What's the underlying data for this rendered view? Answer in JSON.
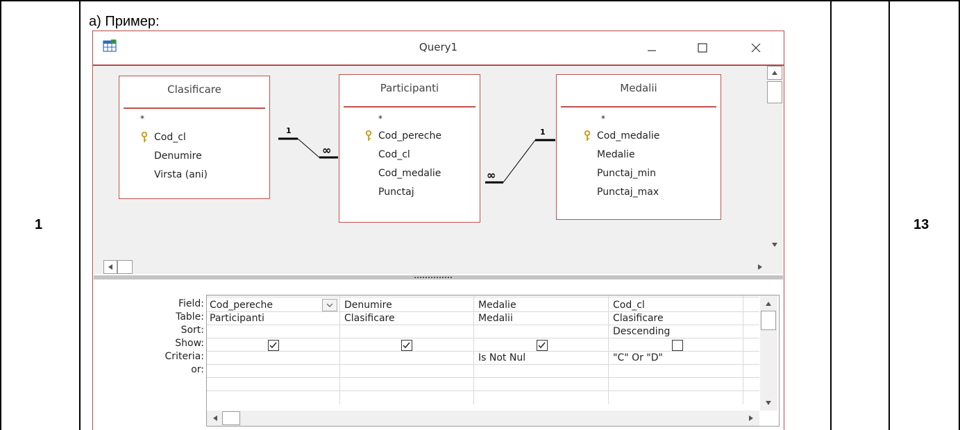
{
  "row": {
    "number": "1",
    "score": "13"
  },
  "example_label": "а) Пример:",
  "window": {
    "title": "Query1"
  },
  "tables": [
    {
      "name": "Clasificare",
      "star": "*",
      "fields": [
        "Cod_cl",
        "Denumire",
        "Virsta (ani)"
      ],
      "key_field": "Cod_cl"
    },
    {
      "name": "Participanti",
      "star": "*",
      "fields": [
        "Cod_pereche",
        "Cod_cl",
        "Cod_medalie",
        "Punctaj"
      ],
      "key_field": "Cod_pereche"
    },
    {
      "name": "Medalii",
      "star": "*",
      "fields": [
        "Cod_medalie",
        "Medalie",
        "Punctaj_min",
        "Punctaj_max"
      ],
      "key_field": "Cod_medalie"
    }
  ],
  "relations": [
    {
      "from": "Clasificare",
      "to": "Participanti",
      "one_label": "1",
      "many_label": "∞"
    },
    {
      "from": "Medalii",
      "to": "Participanti",
      "one_label": "1",
      "many_label": "∞"
    }
  ],
  "grid": {
    "row_labels": [
      "Field:",
      "Table:",
      "Sort:",
      "Show:",
      "Criteria:",
      "or:"
    ],
    "columns": [
      {
        "field": "Cod_pereche",
        "table": "Participanti",
        "sort": "",
        "show": true,
        "criteria": "",
        "or": ""
      },
      {
        "field": "Denumire",
        "table": "Clasificare",
        "sort": "",
        "show": true,
        "criteria": "",
        "or": ""
      },
      {
        "field": "Medalie",
        "table": "Medalii",
        "sort": "",
        "show": true,
        "criteria": "Is Not Nul",
        "or": ""
      },
      {
        "field": "Cod_cl",
        "table": "Clasificare",
        "sort": "Descending",
        "show": false,
        "criteria": "\"C\" Or \"D\"",
        "or": ""
      }
    ]
  },
  "colors": {
    "window_border": "#b5494a",
    "table_border": "#c0504d",
    "pane_bg": "#f0f0f0",
    "key_icon": "#c9a227"
  }
}
